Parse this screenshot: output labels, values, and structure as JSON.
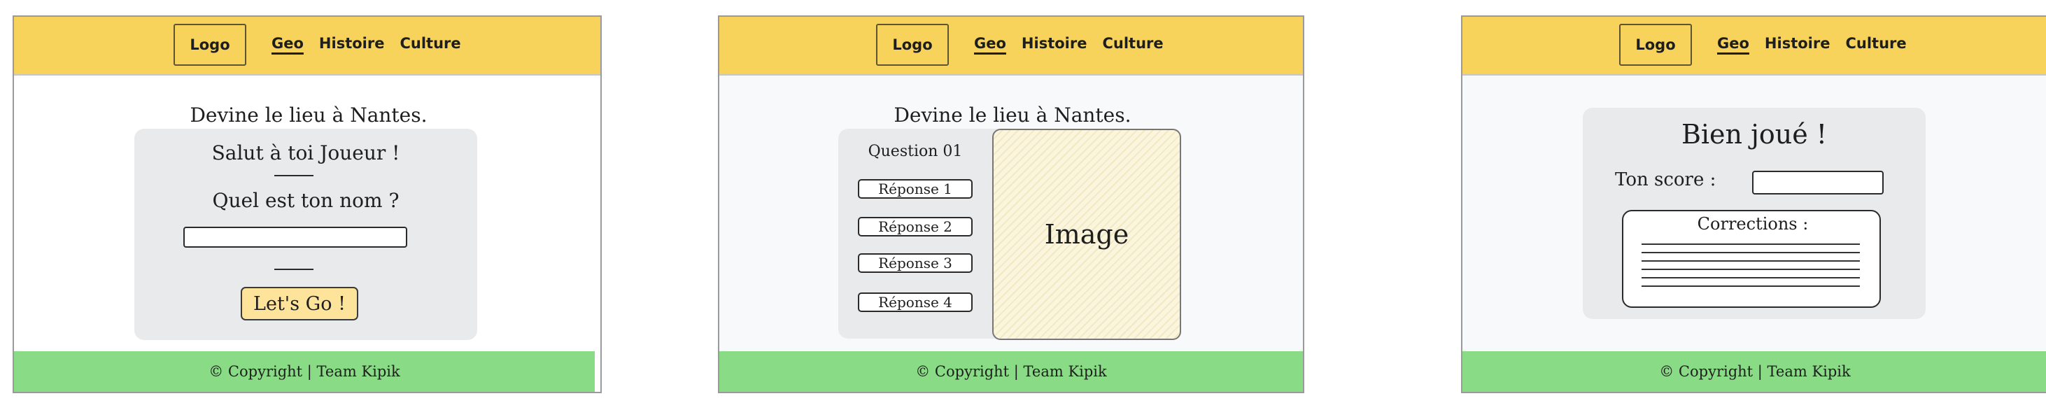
{
  "logo": "Logo",
  "nav": [
    "Geo",
    "Histoire",
    "Culture"
  ],
  "footer": "© Copyright | Team Kipik",
  "screen1": {
    "subtitle": "Devine le lieu à Nantes.",
    "greeting": "Salut à toi Joueur !",
    "question": "Quel est ton nom ?",
    "name_value": "",
    "button": "Let's Go !"
  },
  "screen2": {
    "subtitle": "Devine le lieu à Nantes.",
    "question": "Question 01",
    "answers": [
      "Réponse 1",
      "Réponse 2",
      "Réponse 3",
      "Réponse 4"
    ],
    "image": "Image"
  },
  "screen3": {
    "title": "Bien joué !",
    "score_label": "Ton score :",
    "score_value": "",
    "corrections_label": "Corrections :"
  }
}
